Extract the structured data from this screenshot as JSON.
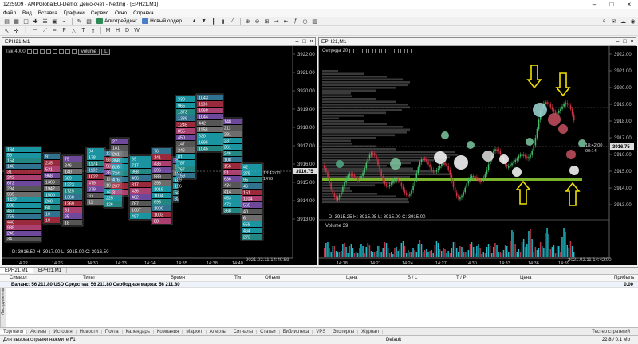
{
  "titlebar": {
    "title": "1225909 - AMPGlobalEU-Demo: Демо-счет - Netting - [EPH21,M1]"
  },
  "menu": [
    "Файл",
    "Вид",
    "Вставка",
    "Графики",
    "Сервис",
    "Окно",
    "Справка"
  ],
  "toolbar": {
    "algo_label": "Алготрейдинг",
    "neworder_label": "Новый ордер"
  },
  "chart1": {
    "window_title": "EPH21,M1",
    "tick_label": "Тик",
    "tick_value": "4000",
    "volume_select": "volume",
    "lot_select": "L",
    "price_badge": "3916.75",
    "time_tag": "18:42:00",
    "count_tag": "1478",
    "ohlc_text": "D: 3916.50  H: 3917.00  L: 3915.00  C: 3916.50",
    "stamp": "2021.02.11  14:40:59",
    "y_ticks": [
      "3922.00",
      "3921.00",
      "3920.00",
      "3919.00",
      "3918.00",
      "3917.00",
      "3916.00",
      "3915.00",
      "3914.00",
      "3913.00"
    ],
    "x_ticks": [
      "14:22",
      "14:26",
      "14:30",
      "14:33",
      "14:34",
      "14:35",
      "14:38",
      "14:40"
    ],
    "cluster_numbers": {
      "c1": [
        "134",
        "59",
        "154",
        "140",
        "31",
        "242",
        "672",
        "294",
        "969",
        "1422",
        "888",
        "467",
        "755",
        "440",
        "939",
        "245",
        "34"
      ],
      "c2": [
        "91",
        "235",
        "531",
        "968",
        "1309",
        "1942",
        "1500",
        "260",
        "68",
        "15",
        "18"
      ],
      "c3": [
        "75",
        "246",
        "140",
        "689",
        "1223",
        "1725",
        "1368",
        "1269",
        "81",
        "65",
        "18"
      ],
      "c4": [
        "94",
        "178",
        "1174",
        "1192",
        "1022",
        "479",
        "279",
        "67",
        "11"
      ],
      "c5": [
        "125",
        "98",
        "581",
        "362",
        "1140",
        "1044",
        "742",
        "225",
        "126"
      ],
      "c6": [
        "27",
        "181",
        "261",
        "358",
        "826",
        "724",
        "476",
        "237",
        "3"
      ],
      "c7": [
        "69",
        "717",
        "958",
        "496",
        "317",
        "436",
        "482",
        "767",
        "1007",
        "497"
      ],
      "c8": [
        "76",
        "141",
        "436",
        "296",
        "589",
        "393",
        "1019",
        "1004",
        "695",
        "1000",
        "1003",
        "88"
      ],
      "c9": [
        "39",
        "27",
        "192",
        "189",
        "156",
        "54",
        "32"
      ],
      "c10": [
        "330",
        "965",
        "1373",
        "1339",
        "1245",
        "855",
        "450",
        "147",
        "246",
        "81",
        "787",
        "767",
        "159"
      ],
      "c11": [
        "1043",
        "1136",
        "1068",
        "1044",
        "442",
        "1158",
        "630",
        "1695",
        "1045"
      ],
      "c12": [
        "148",
        "211",
        "291",
        "237",
        "261",
        "246",
        "108",
        "156",
        "91",
        "636",
        "434",
        "414",
        "453",
        "472",
        "368"
      ],
      "c13": [
        "42",
        "278",
        "95",
        "46",
        "151",
        "1104",
        "565",
        "40",
        "6",
        "658",
        "464",
        "273"
      ]
    }
  },
  "chart2": {
    "window_title": "EPH21,M1",
    "label": "Секунда",
    "label_value": "20",
    "price_badge": "3916.75",
    "time_tag": "18:42:00",
    "count_tag": "00:14",
    "ohlc_text": "D: 3915.25  H: 3915.25  L: 3915.00  C: 3915.00",
    "volume_label": "Volume 39",
    "stamp": "2021.02.11  14:42:00",
    "y_ticks": [
      "3922.00",
      "3921.00",
      "3920.00",
      "3919.00",
      "3918.00",
      "3917.00",
      "3916.00",
      "3915.00",
      "3914.00",
      "3913.00"
    ],
    "x_ticks": [
      "14:18",
      "14:21",
      "14:24",
      "14:27",
      "14:30",
      "14:33",
      "14:36",
      "14:39"
    ]
  },
  "chart_tabs": [
    "EPH21,M1",
    "EPH21,M1"
  ],
  "table": {
    "headers": [
      "Символ",
      "Тикет",
      "Время",
      "Тип",
      "Объем",
      "Цена",
      "S / L",
      "T / P",
      "Цена",
      "Прибыль"
    ],
    "balance_text": "Баланс: 56 211.80 USD  Средства: 56 211.80  Свободная маржа: 56 211.80",
    "balance_value": "0.00"
  },
  "side_label": "Инструменты",
  "terminal_tabs": [
    "Торговля",
    "Активы",
    "История",
    "Новости",
    "Почта",
    "Календарь",
    "Компания",
    "Маркет",
    "Алерты",
    "Сигналы",
    "Статьи",
    "Библиотека",
    "VPS",
    "Эксперты",
    "Журнал"
  ],
  "tester_label": "Тестер стратегий",
  "status": {
    "help": "Для вызова справки нажмите F1",
    "profile": "Default",
    "memory": "22.8 / 0.1 Mb"
  },
  "colors": {
    "cyan": "#1fb9c8",
    "teal": "#2aa7a4",
    "red": "#c0344a",
    "pink": "#d4508c",
    "purple": "#8a5ac0",
    "green_line": "#7bb42d",
    "yellow_arrow": "#f0e000",
    "chart_bg": "#000000"
  }
}
